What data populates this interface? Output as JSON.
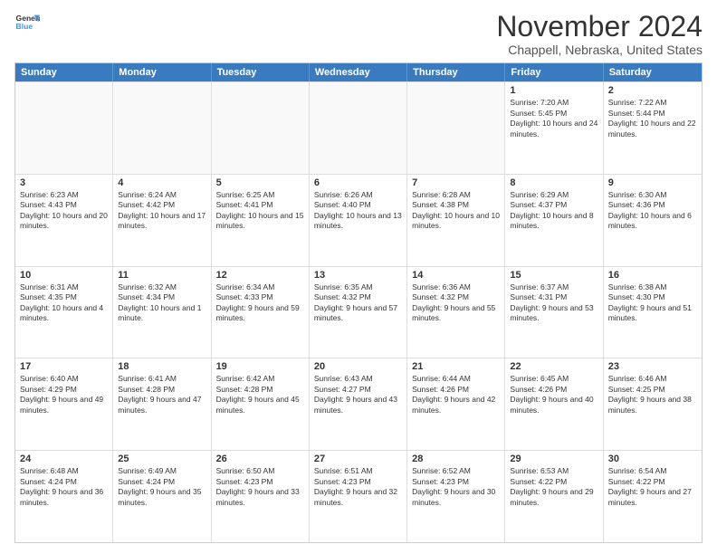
{
  "header": {
    "logo_line1": "General",
    "logo_line2": "Blue",
    "month": "November 2024",
    "location": "Chappell, Nebraska, United States"
  },
  "weekdays": [
    "Sunday",
    "Monday",
    "Tuesday",
    "Wednesday",
    "Thursday",
    "Friday",
    "Saturday"
  ],
  "rows": [
    [
      {
        "day": "",
        "text": "",
        "empty": true
      },
      {
        "day": "",
        "text": "",
        "empty": true
      },
      {
        "day": "",
        "text": "",
        "empty": true
      },
      {
        "day": "",
        "text": "",
        "empty": true
      },
      {
        "day": "",
        "text": "",
        "empty": true
      },
      {
        "day": "1",
        "text": "Sunrise: 7:20 AM\nSunset: 5:45 PM\nDaylight: 10 hours and 24 minutes.",
        "empty": false
      },
      {
        "day": "2",
        "text": "Sunrise: 7:22 AM\nSunset: 5:44 PM\nDaylight: 10 hours and 22 minutes.",
        "empty": false
      }
    ],
    [
      {
        "day": "3",
        "text": "Sunrise: 6:23 AM\nSunset: 4:43 PM\nDaylight: 10 hours and 20 minutes.",
        "empty": false
      },
      {
        "day": "4",
        "text": "Sunrise: 6:24 AM\nSunset: 4:42 PM\nDaylight: 10 hours and 17 minutes.",
        "empty": false
      },
      {
        "day": "5",
        "text": "Sunrise: 6:25 AM\nSunset: 4:41 PM\nDaylight: 10 hours and 15 minutes.",
        "empty": false
      },
      {
        "day": "6",
        "text": "Sunrise: 6:26 AM\nSunset: 4:40 PM\nDaylight: 10 hours and 13 minutes.",
        "empty": false
      },
      {
        "day": "7",
        "text": "Sunrise: 6:28 AM\nSunset: 4:38 PM\nDaylight: 10 hours and 10 minutes.",
        "empty": false
      },
      {
        "day": "8",
        "text": "Sunrise: 6:29 AM\nSunset: 4:37 PM\nDaylight: 10 hours and 8 minutes.",
        "empty": false
      },
      {
        "day": "9",
        "text": "Sunrise: 6:30 AM\nSunset: 4:36 PM\nDaylight: 10 hours and 6 minutes.",
        "empty": false
      }
    ],
    [
      {
        "day": "10",
        "text": "Sunrise: 6:31 AM\nSunset: 4:35 PM\nDaylight: 10 hours and 4 minutes.",
        "empty": false
      },
      {
        "day": "11",
        "text": "Sunrise: 6:32 AM\nSunset: 4:34 PM\nDaylight: 10 hours and 1 minute.",
        "empty": false
      },
      {
        "day": "12",
        "text": "Sunrise: 6:34 AM\nSunset: 4:33 PM\nDaylight: 9 hours and 59 minutes.",
        "empty": false
      },
      {
        "day": "13",
        "text": "Sunrise: 6:35 AM\nSunset: 4:32 PM\nDaylight: 9 hours and 57 minutes.",
        "empty": false
      },
      {
        "day": "14",
        "text": "Sunrise: 6:36 AM\nSunset: 4:32 PM\nDaylight: 9 hours and 55 minutes.",
        "empty": false
      },
      {
        "day": "15",
        "text": "Sunrise: 6:37 AM\nSunset: 4:31 PM\nDaylight: 9 hours and 53 minutes.",
        "empty": false
      },
      {
        "day": "16",
        "text": "Sunrise: 6:38 AM\nSunset: 4:30 PM\nDaylight: 9 hours and 51 minutes.",
        "empty": false
      }
    ],
    [
      {
        "day": "17",
        "text": "Sunrise: 6:40 AM\nSunset: 4:29 PM\nDaylight: 9 hours and 49 minutes.",
        "empty": false
      },
      {
        "day": "18",
        "text": "Sunrise: 6:41 AM\nSunset: 4:28 PM\nDaylight: 9 hours and 47 minutes.",
        "empty": false
      },
      {
        "day": "19",
        "text": "Sunrise: 6:42 AM\nSunset: 4:28 PM\nDaylight: 9 hours and 45 minutes.",
        "empty": false
      },
      {
        "day": "20",
        "text": "Sunrise: 6:43 AM\nSunset: 4:27 PM\nDaylight: 9 hours and 43 minutes.",
        "empty": false
      },
      {
        "day": "21",
        "text": "Sunrise: 6:44 AM\nSunset: 4:26 PM\nDaylight: 9 hours and 42 minutes.",
        "empty": false
      },
      {
        "day": "22",
        "text": "Sunrise: 6:45 AM\nSunset: 4:26 PM\nDaylight: 9 hours and 40 minutes.",
        "empty": false
      },
      {
        "day": "23",
        "text": "Sunrise: 6:46 AM\nSunset: 4:25 PM\nDaylight: 9 hours and 38 minutes.",
        "empty": false
      }
    ],
    [
      {
        "day": "24",
        "text": "Sunrise: 6:48 AM\nSunset: 4:24 PM\nDaylight: 9 hours and 36 minutes.",
        "empty": false
      },
      {
        "day": "25",
        "text": "Sunrise: 6:49 AM\nSunset: 4:24 PM\nDaylight: 9 hours and 35 minutes.",
        "empty": false
      },
      {
        "day": "26",
        "text": "Sunrise: 6:50 AM\nSunset: 4:23 PM\nDaylight: 9 hours and 33 minutes.",
        "empty": false
      },
      {
        "day": "27",
        "text": "Sunrise: 6:51 AM\nSunset: 4:23 PM\nDaylight: 9 hours and 32 minutes.",
        "empty": false
      },
      {
        "day": "28",
        "text": "Sunrise: 6:52 AM\nSunset: 4:23 PM\nDaylight: 9 hours and 30 minutes.",
        "empty": false
      },
      {
        "day": "29",
        "text": "Sunrise: 6:53 AM\nSunset: 4:22 PM\nDaylight: 9 hours and 29 minutes.",
        "empty": false
      },
      {
        "day": "30",
        "text": "Sunrise: 6:54 AM\nSunset: 4:22 PM\nDaylight: 9 hours and 27 minutes.",
        "empty": false
      }
    ]
  ]
}
